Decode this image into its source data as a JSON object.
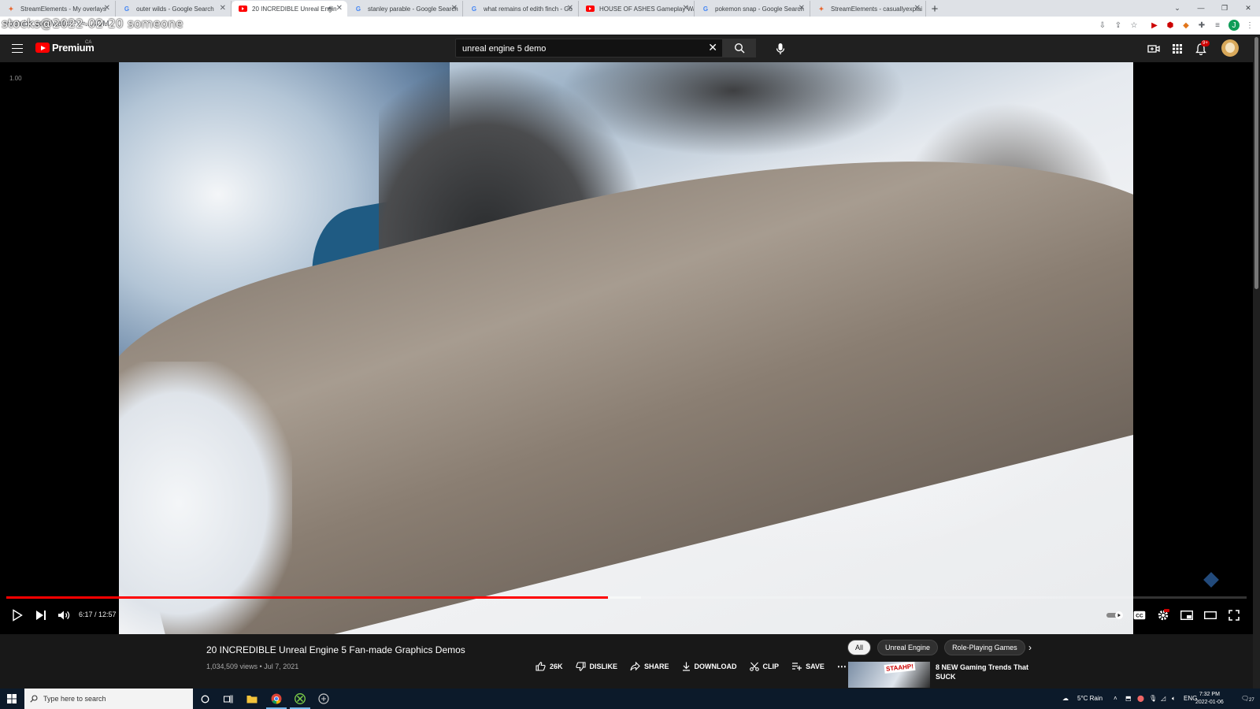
{
  "browser": {
    "tabs": [
      {
        "title": "StreamElements - My overlays",
        "icon": "se"
      },
      {
        "title": "outer wilds - Google Search",
        "icon": "g"
      },
      {
        "title": "20 INCREDIBLE Unreal Engin",
        "icon": "yt",
        "active": true,
        "audio": true
      },
      {
        "title": "stanley parable - Google Search",
        "icon": "g"
      },
      {
        "title": "what remains of edith finch - Go",
        "icon": "g"
      },
      {
        "title": "HOUSE OF ASHES Gameplay Wa",
        "icon": "yt"
      },
      {
        "title": "pokemon snap - Google Search",
        "icon": "g"
      },
      {
        "title": "StreamElements - casuallyexplai",
        "icon": "se"
      }
    ],
    "url": "youtube.com/watch?v=...4OM",
    "watermark": "stocks@2022-02-20 someone"
  },
  "youtube": {
    "brand": "Premium",
    "region": "CA",
    "search_query": "unreal engine 5 demo",
    "notification_count": "9+"
  },
  "player": {
    "stat": "1.00",
    "current_time": "6:17",
    "duration": "12:57",
    "time_display": "6:17 / 12:57",
    "played_fraction": 0.485,
    "buffered_fraction": 0.512
  },
  "video": {
    "title": "20 INCREDIBLE Unreal Engine 5 Fan-made Graphics Demos",
    "meta": "1,034,509 views • Jul 7, 2021",
    "likes": "26K",
    "dislike_label": "DISLIKE",
    "share_label": "SHARE",
    "download_label": "DOWNLOAD",
    "clip_label": "CLIP",
    "save_label": "SAVE"
  },
  "sidebar": {
    "chips": [
      "All",
      "Unreal Engine",
      "Role-Playing Games"
    ],
    "rec_title": "8 NEW Gaming Trends That SUCK",
    "rec_badge": "STAAHP!"
  },
  "taskbar": {
    "search_placeholder": "Type here to search",
    "weather": "5°C  Rain",
    "lang": "ENG",
    "time": "7:32 PM",
    "date": "2022-01-06",
    "notif_count": "27"
  },
  "colors": {
    "accent": "#ff0000",
    "yt_bg": "#0f0f0f",
    "masthead": "#202020",
    "taskbar": "#0c1a2a"
  }
}
